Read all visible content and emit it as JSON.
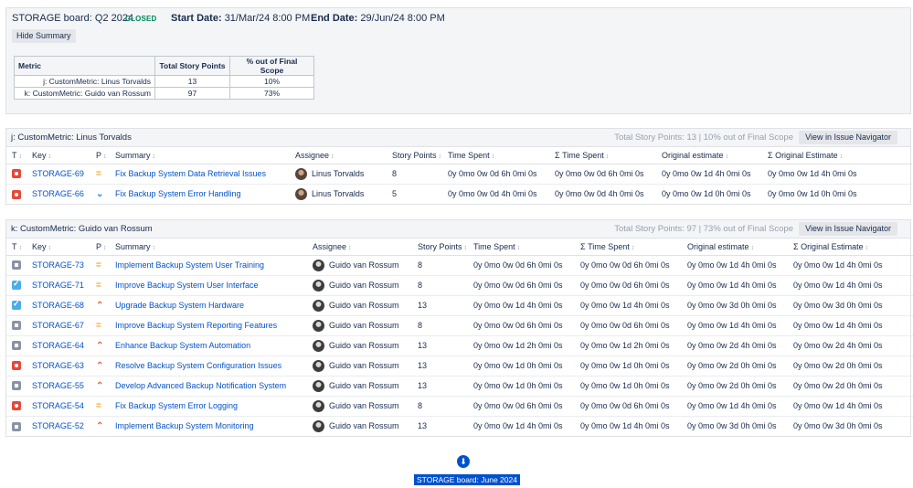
{
  "header": {
    "board_title": "STORAGE board: Q2 2024",
    "status_badge": "CLOSED",
    "start_label": "Start Date:",
    "start_value": "31/Mar/24 8:00 PM",
    "end_label": "End Date:",
    "end_value": "29/Jun/24 8:00 PM",
    "hide_summary_label": "Hide Summary"
  },
  "summary_table": {
    "columns": [
      "Metric",
      "Total Story Points",
      "% out of Final Scope"
    ],
    "rows": [
      {
        "metric": "j: CustomMetric: Linus Torvalds",
        "points": "13",
        "percent": "10%"
      },
      {
        "metric": "k: CustomMetric: Guido van Rossum",
        "points": "97",
        "percent": "73%"
      }
    ]
  },
  "columns": {
    "type": "T",
    "key": "Key",
    "priority": "P",
    "summary": "Summary",
    "assignee": "Assignee",
    "story_points": "Story Points",
    "time_spent": "Time Spent",
    "sum_time_spent": "Σ Time Spent",
    "original_estimate": "Original estimate",
    "sum_original_estimate": "Σ Original Estimate",
    "sort_glyph": "↕"
  },
  "groups": [
    {
      "title": "j: CustomMetric: Linus Torvalds",
      "total": "Total Story Points: 13 | 10% out of Final Scope",
      "view_label": "View in Issue Navigator",
      "issues": [
        {
          "type": "bug",
          "type_icon": "bug-icon",
          "key": "STORAGE-69",
          "priority": "medium",
          "priority_glyph": "=",
          "summary": "Fix Backup System Data Retrieval Issues",
          "assignee": "Linus Torvalds",
          "points": "8",
          "time_spent": "0y 0mo 0w 0d 6h 0mi 0s",
          "sum_time_spent": "0y 0mo 0w 0d 6h 0mi 0s",
          "orig": "0y 0mo 0w 1d 4h 0mi 0s",
          "sum_orig": "0y 0mo 0w 1d 4h 0mi 0s"
        },
        {
          "type": "bug",
          "type_icon": "bug-icon",
          "key": "STORAGE-66",
          "priority": "low",
          "priority_glyph": "⌄",
          "summary": "Fix Backup System Error Handling",
          "assignee": "Linus Torvalds",
          "points": "5",
          "time_spent": "0y 0mo 0w 0d 4h 0mi 0s",
          "sum_time_spent": "0y 0mo 0w 0d 4h 0mi 0s",
          "orig": "0y 0mo 0w 1d 0h 0mi 0s",
          "sum_orig": "0y 0mo 0w 1d 0h 0mi 0s"
        }
      ]
    },
    {
      "title": "k: CustomMetric: Guido van Rossum",
      "total": "Total Story Points: 97 | 73% out of Final Scope",
      "view_label": "View in Issue Navigator",
      "issues": [
        {
          "type": "sub",
          "type_icon": "subtask-icon",
          "key": "STORAGE-73",
          "priority": "medium",
          "priority_glyph": "=",
          "summary": "Implement Backup System User Training",
          "assignee": "Guido van Rossum",
          "points": "8",
          "time_spent": "0y 0mo 0w 0d 6h 0mi 0s",
          "sum_time_spent": "0y 0mo 0w 0d 6h 0mi 0s",
          "orig": "0y 0mo 0w 1d 4h 0mi 0s",
          "sum_orig": "0y 0mo 0w 1d 4h 0mi 0s"
        },
        {
          "type": "task",
          "type_icon": "task-icon",
          "key": "STORAGE-71",
          "priority": "medium",
          "priority_glyph": "=",
          "summary": "Improve Backup System User Interface",
          "assignee": "Guido van Rossum",
          "points": "8",
          "time_spent": "0y 0mo 0w 0d 6h 0mi 0s",
          "sum_time_spent": "0y 0mo 0w 0d 6h 0mi 0s",
          "orig": "0y 0mo 0w 1d 4h 0mi 0s",
          "sum_orig": "0y 0mo 0w 1d 4h 0mi 0s"
        },
        {
          "type": "task",
          "type_icon": "task-icon",
          "key": "STORAGE-68",
          "priority": "high",
          "priority_glyph": "⌃",
          "summary": "Upgrade Backup System Hardware",
          "assignee": "Guido van Rossum",
          "points": "13",
          "time_spent": "0y 0mo 0w 1d 4h 0mi 0s",
          "sum_time_spent": "0y 0mo 0w 1d 4h 0mi 0s",
          "orig": "0y 0mo 0w 3d 0h 0mi 0s",
          "sum_orig": "0y 0mo 0w 3d 0h 0mi 0s"
        },
        {
          "type": "sub",
          "type_icon": "subtask-icon",
          "key": "STORAGE-67",
          "priority": "medium",
          "priority_glyph": "=",
          "summary": "Improve Backup System Reporting Features",
          "assignee": "Guido van Rossum",
          "points": "8",
          "time_spent": "0y 0mo 0w 0d 6h 0mi 0s",
          "sum_time_spent": "0y 0mo 0w 0d 6h 0mi 0s",
          "orig": "0y 0mo 0w 1d 4h 0mi 0s",
          "sum_orig": "0y 0mo 0w 1d 4h 0mi 0s"
        },
        {
          "type": "sub",
          "type_icon": "subtask-icon",
          "key": "STORAGE-64",
          "priority": "high",
          "priority_glyph": "⌃",
          "summary": "Enhance Backup System Automation",
          "assignee": "Guido van Rossum",
          "points": "13",
          "time_spent": "0y 0mo 0w 1d 2h 0mi 0s",
          "sum_time_spent": "0y 0mo 0w 1d 2h 0mi 0s",
          "orig": "0y 0mo 0w 2d 4h 0mi 0s",
          "sum_orig": "0y 0mo 0w 2d 4h 0mi 0s"
        },
        {
          "type": "bug",
          "type_icon": "bug-icon",
          "key": "STORAGE-63",
          "priority": "high",
          "priority_glyph": "⌃",
          "summary": "Resolve Backup System Configuration Issues",
          "assignee": "Guido van Rossum",
          "points": "13",
          "time_spent": "0y 0mo 0w 1d 0h 0mi 0s",
          "sum_time_spent": "0y 0mo 0w 1d 0h 0mi 0s",
          "orig": "0y 0mo 0w 2d 0h 0mi 0s",
          "sum_orig": "0y 0mo 0w 2d 0h 0mi 0s"
        },
        {
          "type": "sub",
          "type_icon": "subtask-icon",
          "key": "STORAGE-55",
          "priority": "high",
          "priority_glyph": "⌃",
          "summary": "Develop Advanced Backup Notification System",
          "assignee": "Guido van Rossum",
          "points": "13",
          "time_spent": "0y 0mo 0w 1d 0h 0mi 0s",
          "sum_time_spent": "0y 0mo 0w 1d 0h 0mi 0s",
          "orig": "0y 0mo 0w 2d 0h 0mi 0s",
          "sum_orig": "0y 0mo 0w 2d 0h 0mi 0s"
        },
        {
          "type": "bug",
          "type_icon": "bug-icon",
          "key": "STORAGE-54",
          "priority": "medium",
          "priority_glyph": "=",
          "summary": "Fix Backup System Error Logging",
          "assignee": "Guido van Rossum",
          "points": "8",
          "time_spent": "0y 0mo 0w 0d 6h 0mi 0s",
          "sum_time_spent": "0y 0mo 0w 0d 6h 0mi 0s",
          "orig": "0y 0mo 0w 1d 4h 0mi 0s",
          "sum_orig": "0y 0mo 0w 1d 4h 0mi 0s"
        },
        {
          "type": "sub",
          "type_icon": "subtask-icon",
          "key": "STORAGE-52",
          "priority": "high",
          "priority_glyph": "⌃",
          "summary": "Implement Backup System Monitoring",
          "assignee": "Guido van Rossum",
          "points": "13",
          "time_spent": "0y 0mo 0w 1d 4h 0mi 0s",
          "sum_time_spent": "0y 0mo 0w 1d 4h 0mi 0s",
          "orig": "0y 0mo 0w 3d 0h 0mi 0s",
          "sum_orig": "0y 0mo 0w 3d 0h 0mi 0s"
        }
      ]
    }
  ],
  "footer": {
    "scroll_icon": "arrow-down-icon",
    "next_board_label": "STORAGE board: June 2024"
  },
  "colors": {
    "link": "#0052cc",
    "closed": "#00875a",
    "bug": "#e5493a",
    "task": "#4bade8",
    "subtask": "#8993a4",
    "priority_medium": "#f5a623",
    "priority_low": "#2684ff",
    "priority_high": "#f15c3b"
  }
}
